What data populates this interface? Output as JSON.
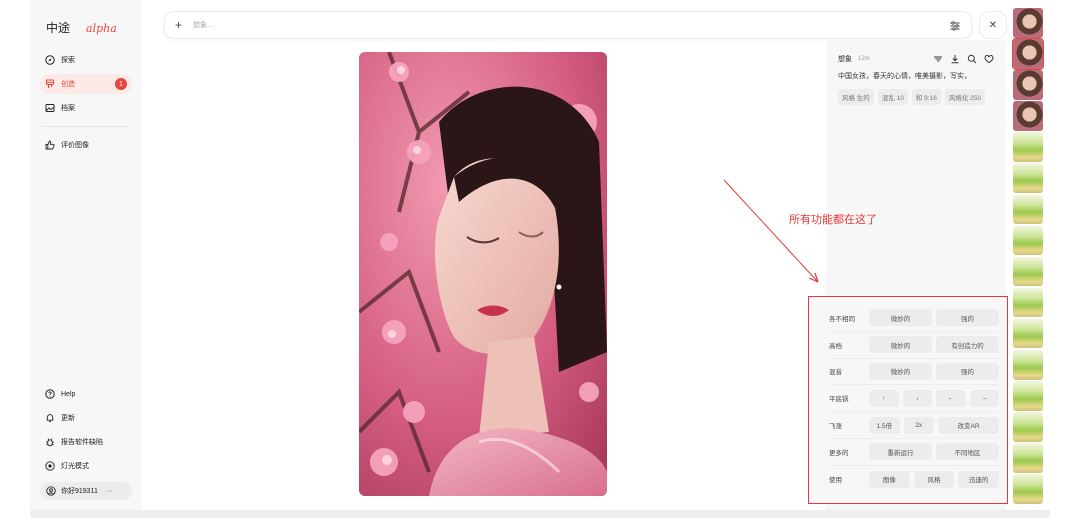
{
  "sidebar": {
    "logo": "中途",
    "logo_tag": "alpha",
    "items": [
      {
        "label": "探索",
        "icon": "compass-icon"
      },
      {
        "label": "创造",
        "icon": "brush-icon",
        "badge": "1"
      },
      {
        "label": "档案",
        "icon": "image-icon"
      },
      {
        "label": "评价图像",
        "icon": "thumbs-up-icon"
      }
    ],
    "bottom_items": [
      {
        "label": "Help",
        "icon": "help-icon"
      },
      {
        "label": "更新",
        "icon": "bell-icon"
      },
      {
        "label": "报告软件缺陷",
        "icon": "bug-icon"
      },
      {
        "label": "灯光模式",
        "icon": "sun-icon"
      }
    ],
    "user": {
      "name": "你好919311",
      "more": "···"
    }
  },
  "prompt_bar": {
    "placeholder": "想象..."
  },
  "detail": {
    "author": "想象",
    "time": "12m",
    "prompt": "中国女孩，春天的心情，唯美摄影，写实，",
    "params": [
      "风格 生的",
      "混乱 10",
      "和 9:16",
      "风格化 250"
    ]
  },
  "annotation": {
    "text": "所有功能都在这了",
    "color": "#e53935"
  },
  "actions": [
    {
      "label": "各不相同",
      "buttons": [
        "微妙的",
        "强的"
      ]
    },
    {
      "label": "高档",
      "buttons": [
        "微妙的",
        "有创造力的"
      ]
    },
    {
      "label": "混音",
      "buttons": [
        "微妙的",
        "强的"
      ]
    },
    {
      "label": "平底锅",
      "buttons": [
        "↑",
        "↓",
        "←",
        "→"
      ]
    },
    {
      "label": "飞涨",
      "buttons": [
        "1.5倍",
        "2x",
        "改变AR"
      ]
    },
    {
      "label": "更多的",
      "buttons": [
        "重新运行",
        "不同地区"
      ]
    },
    {
      "label": "使用",
      "buttons": [
        "图像",
        "风格",
        "迅速的"
      ]
    }
  ],
  "colors": {
    "accent": "#e8453c",
    "annotation": "#e53935"
  }
}
